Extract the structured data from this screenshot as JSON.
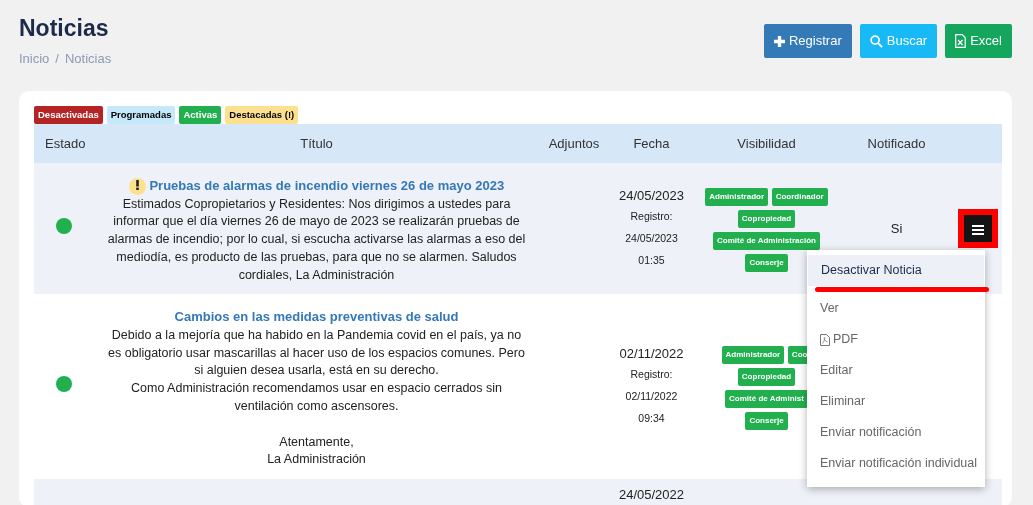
{
  "page": {
    "title": "Noticias"
  },
  "breadcrumb": [
    {
      "label": "Inicio"
    },
    {
      "label": "Noticias"
    }
  ],
  "breadcrumb_separator": "/",
  "actions": [
    {
      "label": "Registrar",
      "kind": "add"
    },
    {
      "label": "Buscar",
      "kind": "search"
    },
    {
      "label": "Excel",
      "kind": "excel"
    }
  ],
  "legend": [
    {
      "label": "Desactivadas",
      "kind": "inactive"
    },
    {
      "label": "Programadas",
      "kind": "scheduled"
    },
    {
      "label": "Activas",
      "kind": "active"
    },
    {
      "label": "Destacadas (!)",
      "kind": "featured"
    }
  ],
  "table": {
    "columns": [
      "Estado",
      "Título",
      "Adjuntos",
      "Fecha",
      "Visibilidad",
      "Notificado"
    ],
    "rows": [
      {
        "color": "#22b04f",
        "featured": true,
        "title": "Pruebas de alarmas de incendio viernes 26 de mayo 2023",
        "body": [
          "Estimados Copropietarios y Residentes: Nos dirigimos a ustedes para informar que el día viernes 26 de mayo de  2023 se realizarán pruebas de alarmas de incendio; por lo cual, si escucha activarse las alarmas a eso del mediodía, es producto de las pruebas, para que no se alarmen. Saludos cordiales, La Administración"
        ],
        "date": "24/05/2023",
        "registered_label": "Registro:",
        "registered_date": "24/05/2023",
        "registered_time": "01:35",
        "visibility": [
          [
            "Administrador",
            "Coordinador"
          ],
          [
            "Copropiedad"
          ],
          [
            "Comité de Administración"
          ],
          [
            "Conserje"
          ]
        ],
        "notified": "Si",
        "menu_button": true
      },
      {
        "color": "#22b04f",
        "featured": false,
        "title": "Cambios en las medidas preventivas de salud",
        "body": [
          "Debido a la mejoría que ha habido en la Pandemia covid en el país, ya no es obligatorio usar mascarillas al hacer uso de los espacios comunes. Pero si alguien desea usarla, está en su derecho.",
          "Como Administración recomendamos usar en espacio cerrados sin ventilación como ascensores."
        ],
        "closing": [
          "Atentamente,",
          "La Administración"
        ],
        "date": "02/11/2022",
        "registered_label": "Registro:",
        "registered_date": "02/11/2022",
        "registered_time": "09:34",
        "visibility": [
          [
            "Administrador",
            "Coo"
          ],
          [
            "Copropiedad"
          ],
          [
            "Comité de Administ"
          ],
          [
            "Conserje"
          ]
        ],
        "menu_button": false
      },
      {
        "date": "24/05/2022"
      }
    ]
  },
  "row_menu": {
    "items": [
      {
        "label": "Desactivar Noticia",
        "kind": "text",
        "highlighted": true
      },
      {
        "label": "Ver",
        "kind": "text",
        "highlighted": false
      },
      {
        "label": "PDF",
        "kind": "pdf",
        "highlighted": false
      },
      {
        "label": "Editar",
        "kind": "text",
        "highlighted": false
      },
      {
        "label": "Eliminar",
        "kind": "text",
        "highlighted": false
      },
      {
        "label": "Enviar notificación",
        "kind": "text",
        "highlighted": false
      },
      {
        "label": "Enviar notificación individual",
        "kind": "text",
        "highlighted": false
      }
    ]
  }
}
